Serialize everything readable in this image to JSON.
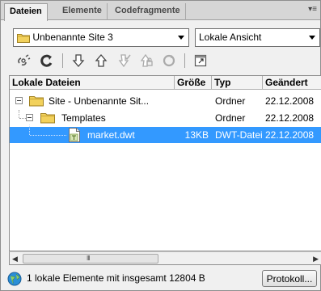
{
  "tabs": [
    {
      "label": "Dateien",
      "active": true
    },
    {
      "label": "Elemente",
      "active": false
    },
    {
      "label": "Codefragmente",
      "active": false
    }
  ],
  "site_select": {
    "value": "Unbenannte Site 3",
    "icon": "folder-icon"
  },
  "view_select": {
    "value": "Lokale Ansicht"
  },
  "toolbar": {
    "buttons": [
      {
        "name": "connect-icon"
      },
      {
        "name": "refresh-icon"
      },
      {
        "name": "get-files-icon"
      },
      {
        "name": "put-files-icon"
      },
      {
        "name": "check-out-icon"
      },
      {
        "name": "check-in-icon"
      },
      {
        "name": "synchronize-icon"
      },
      {
        "name": "expand-panel-icon"
      }
    ]
  },
  "columns": {
    "name": "Lokale Dateien",
    "size": "Größe",
    "type": "Typ",
    "modified": "Geändert"
  },
  "rows": [
    {
      "name": "Site - Unbenannte Sit...",
      "size": "",
      "type": "Ordner",
      "modified": "22.12.2008",
      "selected": false
    },
    {
      "name": "Templates",
      "size": "",
      "type": "Ordner",
      "modified": "22.12.2008",
      "selected": false
    },
    {
      "name": "market.dwt",
      "size": "13KB",
      "type": "DWT-Datei",
      "modified": "22.12.2008",
      "selected": true
    }
  ],
  "scrollbar": {
    "grip": "III"
  },
  "status": {
    "text": "1 lokale Elemente mit insgesamt 12804 B",
    "log_button": "Protokoll..."
  },
  "colors": {
    "selection": "#3399ff",
    "folder": "#f2d15c",
    "globe": "#2a8fd8"
  }
}
